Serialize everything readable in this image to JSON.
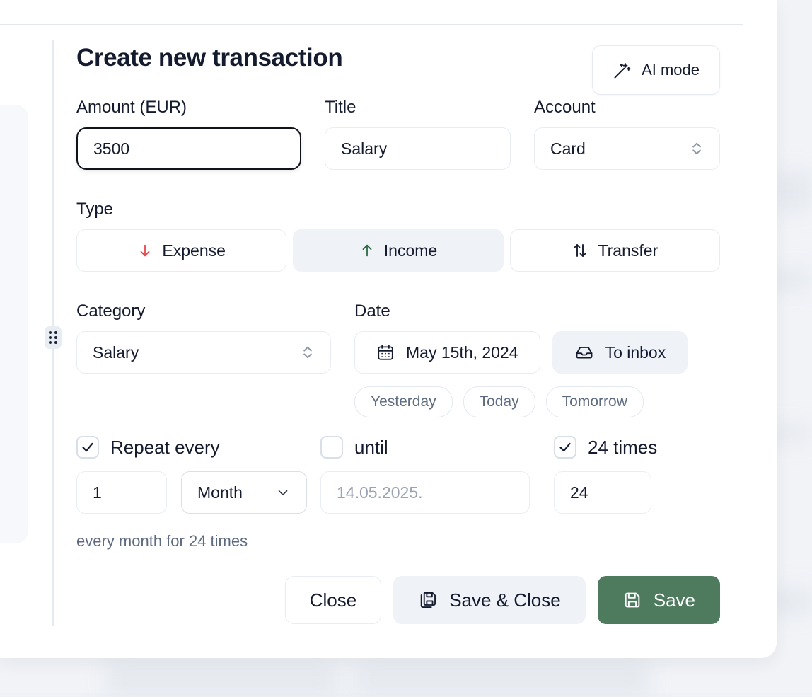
{
  "panel": {
    "title": "Create new transaction",
    "ai_button": {
      "label": "AI mode",
      "icon": "magic-wand-icon"
    },
    "drag_handle_icon": "drag-dots-icon"
  },
  "fields": {
    "amount": {
      "label": "Amount (EUR)",
      "value": "3500",
      "focused": true
    },
    "title": {
      "label": "Title",
      "value": "Salary"
    },
    "account": {
      "label": "Account",
      "value": "Card",
      "icon": "chevron-up-down-icon"
    },
    "category": {
      "label": "Category",
      "value": "Salary",
      "icon": "chevron-up-down-icon"
    }
  },
  "type": {
    "label": "Type",
    "options": [
      {
        "label": "Expense",
        "icon": "arrow-down-icon",
        "color": "#e5484d",
        "active": false
      },
      {
        "label": "Income",
        "icon": "arrow-up-icon",
        "color": "#2f6b47",
        "active": true
      },
      {
        "label": "Transfer",
        "icon": "arrows-up-down-icon",
        "color": "#141b2e",
        "active": false
      }
    ]
  },
  "date": {
    "label": "Date",
    "value": "May 15th, 2024",
    "calendar_icon": "calendar-icon",
    "inbox_button": {
      "label": "To inbox",
      "icon": "inbox-icon"
    },
    "quick_picks": [
      "Yesterday",
      "Today",
      "Tomorrow"
    ]
  },
  "repeat": {
    "repeat_every": {
      "label": "Repeat every",
      "checked": true
    },
    "until": {
      "label": "until",
      "checked": false
    },
    "times": {
      "label": "24 times",
      "checked": true
    },
    "interval_value": "1",
    "unit_value": "Month",
    "unit_icon": "chevron-down-icon",
    "until_placeholder": "14.05.2025.",
    "until_value": "",
    "times_value": "24",
    "summary": "every month for 24 times"
  },
  "footer": {
    "close": {
      "label": "Close"
    },
    "save_close": {
      "label": "Save & Close",
      "icon": "save-copy-icon"
    },
    "save": {
      "label": "Save",
      "icon": "save-icon"
    }
  },
  "colors": {
    "primary_green": "#4e7a5e",
    "expense_red": "#e5484d",
    "income_green": "#2f6b47",
    "muted_text": "#5d6a80",
    "placeholder": "#9aa3b2"
  }
}
